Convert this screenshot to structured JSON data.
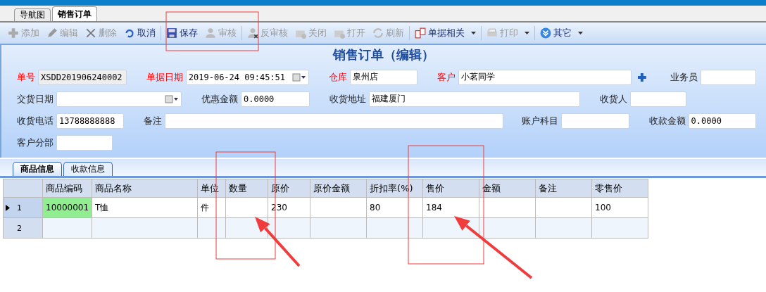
{
  "doc_tabs": [
    {
      "label": "导航图",
      "selected": false
    },
    {
      "label": "销售订单",
      "selected": true
    }
  ],
  "toolbar": [
    {
      "label": "添加",
      "disabled": true
    },
    {
      "label": "编辑",
      "disabled": true
    },
    {
      "label": "删除",
      "disabled": true
    },
    {
      "label": "取消",
      "disabled": false
    },
    {
      "label": "保存",
      "disabled": false,
      "separator_before": true
    },
    {
      "label": "审核",
      "disabled": true
    },
    {
      "label": "反审核",
      "disabled": true,
      "separator_before": true
    },
    {
      "label": "关闭",
      "disabled": true
    },
    {
      "label": "打开",
      "disabled": true
    },
    {
      "label": "刷新",
      "disabled": true
    },
    {
      "label": "单据相关",
      "disabled": false,
      "dropdown": true,
      "separator_before": true
    },
    {
      "label": "打印",
      "disabled": true,
      "dropdown": true,
      "separator_before": true
    },
    {
      "label": "其它",
      "disabled": false,
      "dropdown": true,
      "separator_before": true
    }
  ],
  "form": {
    "title": "销售订单（编辑）",
    "rows": [
      {
        "fields": [
          {
            "label": "单号",
            "value": "XSDD201906240002",
            "required": true,
            "kind": "readonly"
          },
          {
            "label": "单据日期",
            "value": "2019-06-24 09:45:51",
            "required": true,
            "kind": "date"
          },
          {
            "label": "仓库",
            "value": "泉州店",
            "required": true,
            "kind": "text"
          },
          {
            "label": "客户",
            "value": "小茗同学",
            "required": true,
            "kind": "lookup"
          },
          {
            "label": "业务员",
            "required": false,
            "kind": "text"
          }
        ]
      },
      {
        "fields": [
          {
            "label": "交货日期",
            "required": false,
            "kind": "date"
          },
          {
            "label": "优惠金额",
            "value": "0.0000",
            "required": false,
            "kind": "text"
          },
          {
            "label": "收货地址",
            "value": "福建厦门",
            "required": false,
            "kind": "text"
          },
          {
            "label": "收货人",
            "required": false,
            "kind": "text"
          }
        ]
      },
      {
        "fields": [
          {
            "label": "收货电话",
            "value": "13788888888",
            "required": false,
            "kind": "text"
          },
          {
            "label": "备注",
            "required": false,
            "kind": "text"
          },
          {
            "label": "账户科目",
            "required": false,
            "kind": "text"
          },
          {
            "label": "收款金额",
            "value": "0.0000",
            "required": false,
            "kind": "text"
          }
        ]
      },
      {
        "fields": [
          {
            "label": "客户分部",
            "required": false,
            "kind": "text"
          }
        ]
      }
    ]
  },
  "detail_tabs": [
    {
      "label": "商品信息",
      "selected": true
    },
    {
      "label": "收款信息",
      "selected": false
    }
  ],
  "table": {
    "columns": [
      "商品编码",
      "商品名称",
      "单位",
      "数量",
      "原价",
      "原价金额",
      "折扣率(%)",
      "售价",
      "金额",
      "备注",
      "零售价"
    ],
    "rows": [
      {
        "number": "1",
        "current": true,
        "cells": [
          {
            "text": "10000001",
            "selected": true
          },
          {
            "text": "T恤",
            "selected": false
          },
          {
            "text": "件",
            "selected": false
          },
          {
            "selected": false
          },
          {
            "text": "230",
            "selected": false
          },
          {
            "selected": false
          },
          {
            "text": "80",
            "selected": false
          },
          {
            "text": "184",
            "selected": false
          },
          {
            "selected": false
          },
          {
            "selected": false
          },
          {
            "text": "100",
            "selected": false
          }
        ]
      },
      {
        "number": "2",
        "current": false,
        "cells": [
          {
            "selected": false
          },
          {
            "selected": false
          },
          {
            "selected": false
          },
          {
            "selected": false
          },
          {
            "selected": false
          },
          {
            "selected": false
          },
          {
            "selected": false
          },
          {
            "selected": false
          },
          {
            "selected": false
          },
          {
            "selected": false
          },
          {
            "selected": false
          }
        ]
      }
    ]
  },
  "annotations": [
    {
      "kind": "box"
    },
    {
      "kind": "box"
    },
    {
      "kind": "arrow"
    },
    {
      "kind": "box"
    },
    {
      "kind": "arrow"
    }
  ]
}
